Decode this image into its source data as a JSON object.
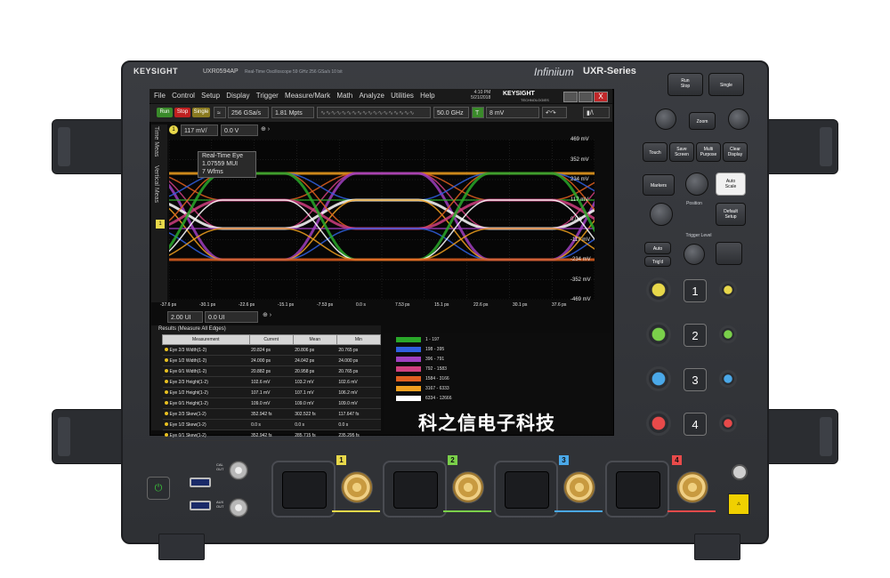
{
  "instrument": {
    "brand": "KEYSIGHT",
    "model": "UXR0594AP",
    "model_sub": "Real-Time Oscilloscope  59 GHz  256 GSa/s  10 bit",
    "family": "Infiniium",
    "series": "UXR-Series"
  },
  "screen": {
    "menu": [
      "File",
      "Control",
      "Setup",
      "Display",
      "Trigger",
      "Measure/Mark",
      "Math",
      "Analyze",
      "Utilities",
      "Help"
    ],
    "datetime": [
      "4:10 PM",
      "5/21/2018"
    ],
    "logo": "KEYSIGHT",
    "logo_sub": "TECHNOLOGIES",
    "close_label": "X",
    "toolbar": {
      "run": "Run",
      "stop": "Stop",
      "single": "Single",
      "sample_rate": "256 GSa/s",
      "memory": "1.81 Mpts",
      "bandwidth": "50.0 GHz",
      "trigger_level": "8 mV"
    },
    "channel": {
      "number": "1",
      "scale": "117 mV/",
      "offset": "0.0 V"
    },
    "side_tabs": [
      "Time Meas",
      "Vertical Meas"
    ],
    "eye_label": [
      "Real-Time Eye",
      "1.07559 MUI",
      "7 Wfms"
    ],
    "y_labels": [
      "469 mV",
      "352 mV",
      "234 mV",
      "117 mV",
      "0.0 V",
      "-117 mV",
      "-234 mV",
      "-352 mV",
      "-469 mV"
    ],
    "x_labels": [
      "-37.6 ps",
      "-30.1 ps",
      "-22.6 ps",
      "-15.1 ps",
      "-7.53 ps",
      "0.0 s",
      "7.53 ps",
      "15.1 ps",
      "22.6 ps",
      "30.1 ps",
      "37.6 ps"
    ],
    "horizontal": {
      "scale": "2.00 UI",
      "position": "0.0 UI"
    },
    "results": {
      "title": "Results (Measure All Edges)",
      "headers": [
        "Measurement",
        "Current",
        "Mean",
        "Min"
      ],
      "rows": [
        {
          "name": "Eye 2/3 Width(1-2)",
          "current": "20.824 ps",
          "mean": "20.806 ps",
          "min": "20.765 ps",
          "color": "#e8c020"
        },
        {
          "name": "Eye 1/2 Width(1-2)",
          "current": "24.000 ps",
          "mean": "24.042 ps",
          "min": "24.000 ps",
          "color": "#e8c020"
        },
        {
          "name": "Eye 0/1 Width(1-2)",
          "current": "20.882 ps",
          "mean": "20.958 ps",
          "min": "20.765 ps",
          "color": "#e8c020"
        },
        {
          "name": "Eye 2/3 Height(1-2)",
          "current": "102.6 mV",
          "mean": "103.2 mV",
          "min": "102.6 mV",
          "color": "#e8c020"
        },
        {
          "name": "Eye 1/2 Height(1-2)",
          "current": "107.1 mV",
          "mean": "107.1 mV",
          "min": "106.2 mV",
          "color": "#e8c020"
        },
        {
          "name": "Eye 0/1 Height(1-2)",
          "current": "109.0 mV",
          "mean": "109.0 mV",
          "min": "109.0 mV",
          "color": "#e8c020"
        },
        {
          "name": "Eye 2/3 Skew(1-2)",
          "current": "352.942 fs",
          "mean": "302.522 fs",
          "min": "117.647 fs",
          "color": "#e8c020"
        },
        {
          "name": "Eye 1/2 Skew(1-2)",
          "current": "0.0 s",
          "mean": "0.0 s",
          "min": "0.0 s",
          "color": "#e8c020"
        },
        {
          "name": "Eye 0/1 Skew(1-2)",
          "current": "352.942 fs",
          "mean": "285.715 fs",
          "min": "235.295 fs",
          "color": "#e8c020"
        }
      ]
    },
    "color_grade": [
      {
        "range": "1 - 197",
        "color": "#2aa82a"
      },
      {
        "range": "198 - 395",
        "color": "#3060e0"
      },
      {
        "range": "396 - 791",
        "color": "#a040c0"
      },
      {
        "range": "792 - 1583",
        "color": "#d04080"
      },
      {
        "range": "1584 - 3166",
        "color": "#e06020"
      },
      {
        "range": "3167 - 6333",
        "color": "#f0a020"
      },
      {
        "range": "6334 - 12666",
        "color": "#ffffff"
      }
    ]
  },
  "watermark": "科之信电子科技",
  "front_panel": {
    "run_stop": "Run\nStop",
    "single": "Single",
    "zoom": "Zoom",
    "touch": "Touch",
    "save_screen": "Save\nScreen",
    "multi_purpose": "Multi\nPurpose",
    "clear_display": "Clear\nDisplay",
    "markers": "Markers",
    "auto_scale": "Auto\nScale",
    "position": "Position",
    "default_setup": "Default\nSetup",
    "trigger_level": "Trigger Level",
    "auto": "Auto",
    "trigd": "Trig'd",
    "channels": [
      "1",
      "2",
      "3",
      "4"
    ],
    "channel_colors": [
      "#e8d84a",
      "#7ad04a",
      "#4aa8e8",
      "#e84a4a"
    ],
    "cal_out": "CAL\nOUT",
    "aux_out": "AUX\nOUT"
  }
}
